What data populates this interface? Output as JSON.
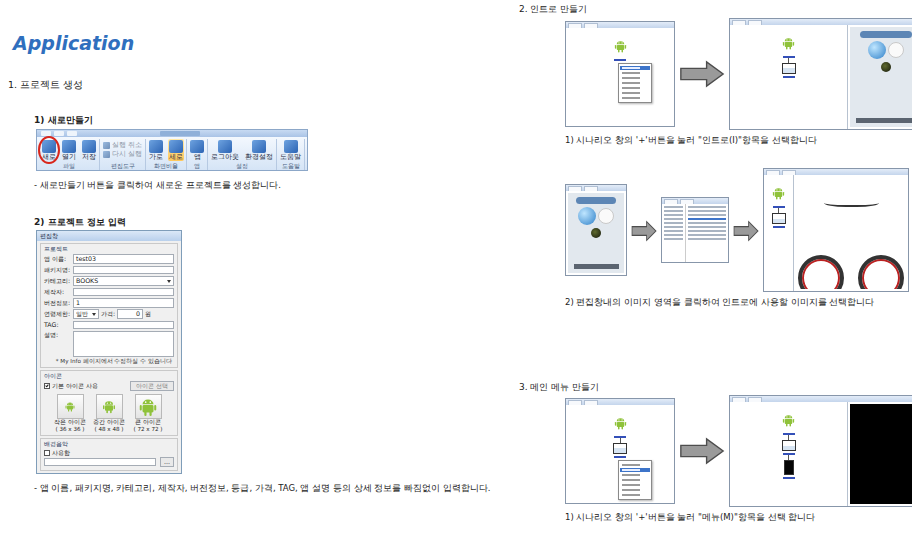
{
  "title": "Application",
  "left": {
    "section": "1. 프로젝트 생성",
    "steps": [
      {
        "heading": "1) 새로만들기",
        "caption": "- 새로만들기 버튼을 클릭하여 새로운 프로젝트를 생성합니다."
      },
      {
        "heading": "2) 프로젝트 정보 입력",
        "caption": "- 앱 이름, 패키지명, 카테고리, 제작자, 버전정보, 등급, 가격, TAG, 앱 설명 등의 상세 정보를 빠짐없이 입력합니다."
      }
    ]
  },
  "ribbon": {
    "groups": [
      {
        "label": "파일",
        "buttons": [
          {
            "label": "새로",
            "kind": "large",
            "highlighted": true,
            "selected": false,
            "disabled": false
          },
          {
            "label": "열기",
            "kind": "large",
            "highlighted": false,
            "selected": false,
            "disabled": false
          },
          {
            "label": "저장",
            "kind": "large",
            "highlighted": false,
            "selected": false,
            "disabled": false
          }
        ]
      },
      {
        "label": "편집도구",
        "buttons": [
          {
            "label": "실행 취소",
            "kind": "small",
            "highlighted": false,
            "selected": false,
            "disabled": true
          },
          {
            "label": "다시 실행",
            "kind": "small",
            "highlighted": false,
            "selected": false,
            "disabled": true
          }
        ]
      },
      {
        "label": "화면비율",
        "buttons": [
          {
            "label": "가로",
            "kind": "large",
            "highlighted": false,
            "selected": false,
            "disabled": false
          },
          {
            "label": "세로",
            "kind": "large",
            "highlighted": false,
            "selected": true,
            "disabled": false
          }
        ]
      },
      {
        "label": "앱",
        "buttons": [
          {
            "label": "앱",
            "kind": "large",
            "highlighted": false,
            "selected": false,
            "disabled": false
          }
        ]
      },
      {
        "label": "설정",
        "buttons": [
          {
            "label": "로그아웃",
            "kind": "large",
            "highlighted": false,
            "selected": false,
            "disabled": false
          },
          {
            "label": "환경설정",
            "kind": "large",
            "highlighted": false,
            "selected": false,
            "disabled": false
          }
        ]
      },
      {
        "label": "도움말",
        "buttons": [
          {
            "label": "도움말",
            "kind": "large",
            "highlighted": false,
            "selected": false,
            "disabled": false
          }
        ]
      }
    ]
  },
  "dialog": {
    "title": "편집창",
    "group": "프로젝트",
    "fields": [
      {
        "label": "앱 이름:",
        "kind": "text",
        "value": "test03"
      },
      {
        "label": "패키지명:",
        "kind": "text"
      },
      {
        "label": "카테고리:",
        "kind": "select",
        "value": "BOOKS"
      },
      {
        "label": "제작자:",
        "kind": "text"
      },
      {
        "label": "버전정보:",
        "kind": "text",
        "value": "1"
      },
      {
        "label": "연령제한:",
        "kind": "select-price",
        "value": "일반",
        "price_label": "가격:",
        "price": "0",
        "unit": "원"
      },
      {
        "label": "TAG:",
        "kind": "text"
      },
      {
        "label": "설명:",
        "kind": "textarea"
      }
    ],
    "note": "* My Info 페이지에서 수정하실 수 있습니다",
    "icon_group": "아이콘",
    "default_icon": {
      "label": "기본 아이콘 사용",
      "checked": true
    },
    "icon_button": "아이콘 선택",
    "icons": [
      {
        "label": "작은 아이콘",
        "size": "( 36 x 36 )",
        "kind": "small"
      },
      {
        "label": "중간 아이콘",
        "size": "( 48 x 48 )",
        "kind": "medium"
      },
      {
        "label": "큰 아이콘",
        "size": "( 72 x 72 )",
        "kind": "large"
      }
    ],
    "music_group": "배경음악",
    "music": {
      "label": "사용함",
      "checked": false
    },
    "browse": "..."
  },
  "right": {
    "sections": [
      {
        "heading": "2. 인트로 만들기",
        "steps": [
          {
            "caption": "1) 시나리오 창의 '+'버튼을 눌러 \"인트로(I)\"항목을 선택합니다",
            "frames": [
              {
                "kind": "scenario",
                "nodes": [
                  {
                    "kind": "android"
                  }
                ],
                "menu": {
                  "open": true,
                  "items": [
                    {
                      "selected": true
                    },
                    {
                      "selected": false
                    },
                    {
                      "selected": false
                    },
                    {
                      "selected": false
                    },
                    {
                      "selected": false
                    },
                    {
                      "selected": false
                    },
                    {
                      "selected": false
                    }
                  ]
                }
              },
              {
                "kind": "split",
                "nodes": [
                  {
                    "kind": "android"
                  },
                  {
                    "kind": "intro"
                  }
                ],
                "preview": "intro-image"
              }
            ]
          },
          {
            "caption": "2) 편집창내의 이미지 영역을 클릭하여 인트로에 사용할 이미지를 선택합니다",
            "frames": [
              {
                "kind": "phone",
                "preview": "intro-image"
              },
              {
                "kind": "file-dialog"
              },
              {
                "kind": "editor",
                "nodes": [
                  {
                    "kind": "android"
                  },
                  {
                    "kind": "intro"
                  }
                ],
                "preview": "photo"
              }
            ]
          }
        ]
      },
      {
        "heading": "3. 메인 메뉴 만들기",
        "steps": [
          {
            "caption": "1) 시나리오 창의 '+'버튼을 눌러 \"메뉴(M)\"항목을 선택 합니다",
            "frames": [
              {
                "kind": "scenario",
                "nodes": [
                  {
                    "kind": "android"
                  },
                  {
                    "kind": "intro"
                  }
                ],
                "menu": {
                  "open": true,
                  "items": [
                    {
                      "selected": false
                    },
                    {
                      "selected": true
                    },
                    {
                      "selected": false
                    },
                    {
                      "selected": false
                    },
                    {
                      "selected": false
                    },
                    {
                      "selected": false
                    },
                    {
                      "selected": false
                    }
                  ]
                }
              },
              {
                "kind": "split",
                "nodes": [
                  {
                    "kind": "android"
                  },
                  {
                    "kind": "intro"
                  },
                  {
                    "kind": "menu"
                  }
                ],
                "preview": "black"
              }
            ]
          }
        ]
      }
    ]
  }
}
